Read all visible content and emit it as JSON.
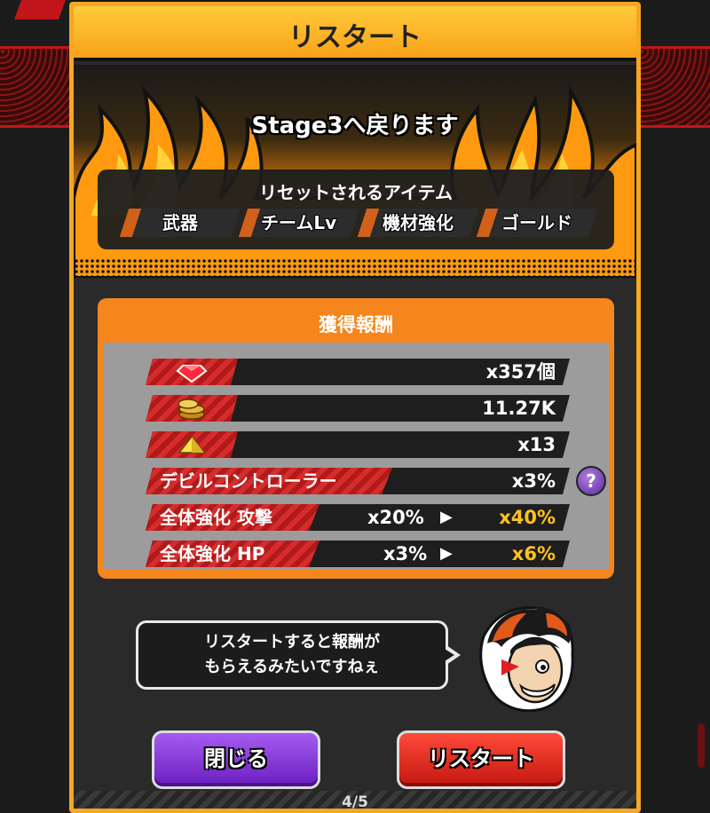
{
  "dialog": {
    "title": "リスタート",
    "stage_message": "Stage3へ戻ります"
  },
  "reset": {
    "title": "リセットされるアイテム",
    "items": [
      "武器",
      "チームLv",
      "機材強化",
      "ゴールド"
    ]
  },
  "rewards": {
    "title": "獲得報酬",
    "gems": "x357個",
    "coins": "11.27K",
    "pyramid": "x13",
    "devil_controller": {
      "label": "デビルコントローラー",
      "value": "x3%"
    },
    "attack_boost": {
      "label": "全体強化 攻撃",
      "from": "x20%",
      "to": "x40%"
    },
    "hp_boost": {
      "label": "全体強化 HP",
      "from": "x3%",
      "to": "x6%"
    },
    "help": "?"
  },
  "speech": {
    "line1": "リスタートすると報酬が",
    "line2": "もらえるみたいですねぇ"
  },
  "buttons": {
    "close": "閉じる",
    "restart": "リスタート"
  },
  "arrow": "▶",
  "page": "4/5",
  "colors": {
    "frame_orange": "#f5a623",
    "highlight_yellow": "#ffc21e",
    "close_purple": "#7b2fd4",
    "restart_red": "#e0261a"
  }
}
